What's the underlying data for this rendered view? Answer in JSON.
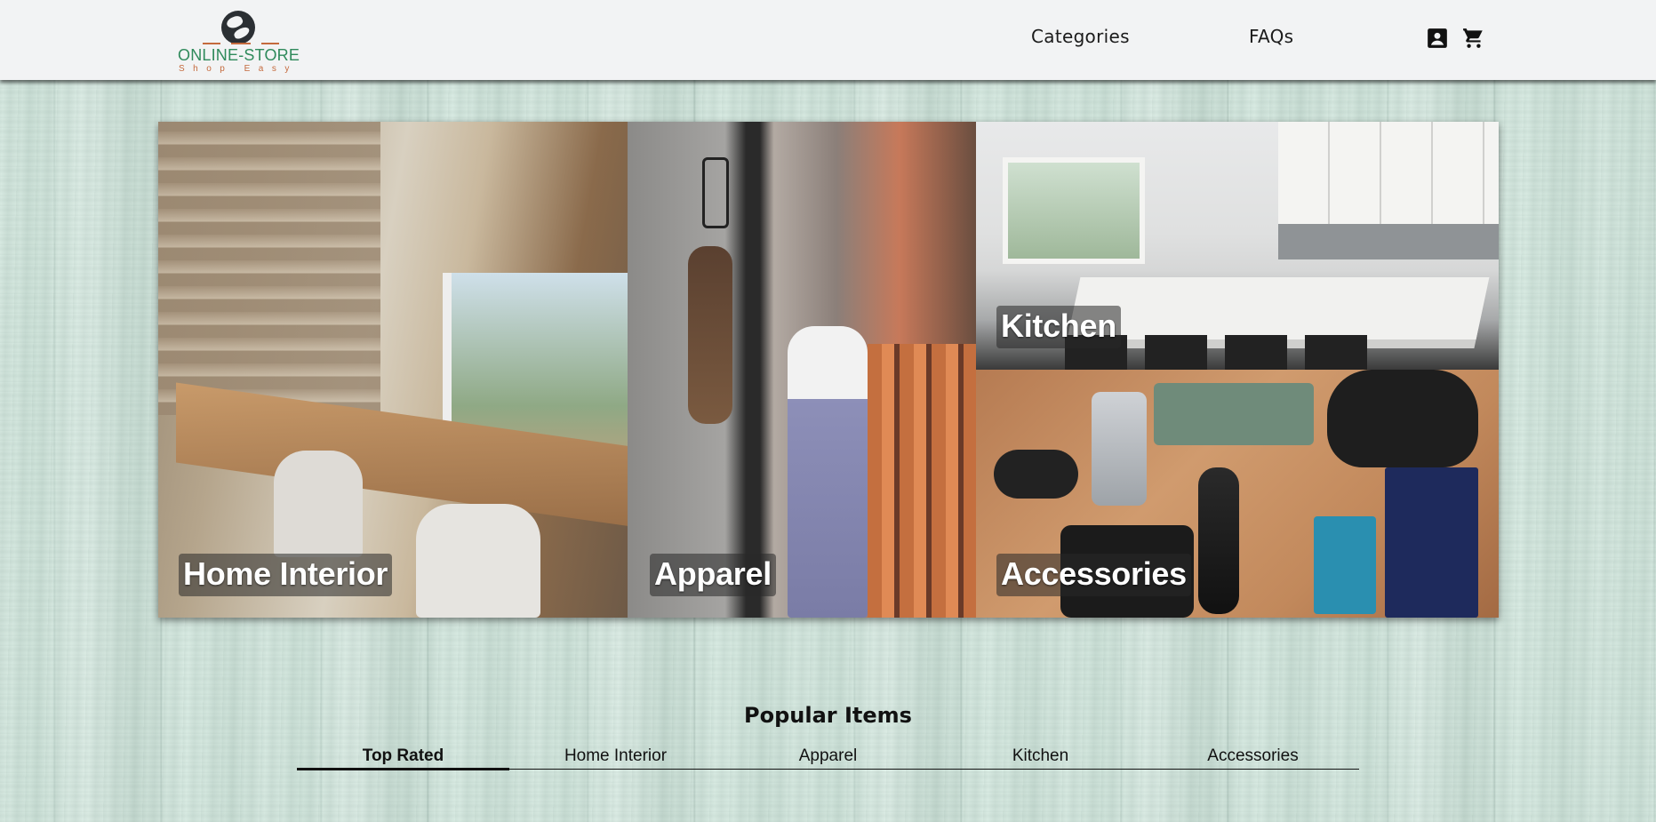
{
  "header": {
    "logo": {
      "name": "ONLINE-STORE",
      "tagline": "Shop Easy"
    },
    "nav": [
      {
        "label": "Categories"
      },
      {
        "label": "FAQs"
      }
    ],
    "icons": [
      "account-icon",
      "cart-icon"
    ]
  },
  "categories": [
    {
      "label": "Home Interior"
    },
    {
      "label": "Apparel"
    },
    {
      "label": "Kitchen"
    },
    {
      "label": "Accessories"
    }
  ],
  "popular": {
    "title": "Popular Items",
    "tabs": [
      {
        "label": "Top Rated",
        "active": true
      },
      {
        "label": "Home Interior",
        "active": false
      },
      {
        "label": "Apparel",
        "active": false
      },
      {
        "label": "Kitchen",
        "active": false
      },
      {
        "label": "Accessories",
        "active": false
      }
    ]
  },
  "colors": {
    "header_bg": "#f2f3f4",
    "logo_green": "#2f8a5b",
    "logo_accent": "#c46a3d",
    "background": "#d7e9e1"
  }
}
